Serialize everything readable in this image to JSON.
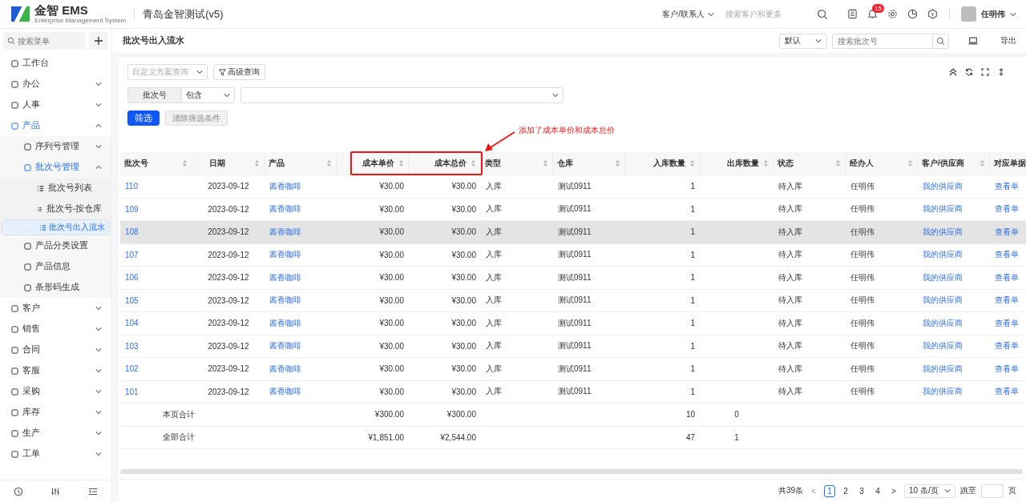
{
  "header": {
    "brand": "金智 EMS",
    "brand_sub": "Enterprise Management System",
    "company": "青岛金智测试(v5)",
    "search_scope": "客户/联系人",
    "search_placeholder": "搜索客户和更多",
    "notification_count": "15",
    "user": "任明伟"
  },
  "sidebar": {
    "search_placeholder": "搜索菜单",
    "items": [
      {
        "label": "工作台",
        "selected": false
      },
      {
        "label": "办公",
        "selected": false,
        "expanded": false
      },
      {
        "label": "人事",
        "selected": false,
        "expanded": false
      },
      {
        "label": "产品",
        "selected": false,
        "expanded": true,
        "active": true,
        "children": [
          {
            "label": "序列号管理",
            "selected": false,
            "expanded": false
          },
          {
            "label": "批次号管理",
            "selected": false,
            "expanded": true,
            "active": true,
            "children": [
              {
                "label": "批次号列表",
                "selected": false
              },
              {
                "label": "批次号-按仓库",
                "selected": false
              },
              {
                "label": "批次号出入流水",
                "selected": true
              }
            ]
          },
          {
            "label": "产品分类设置",
            "selected": false
          },
          {
            "label": "产品信息",
            "selected": false
          },
          {
            "label": "条形码生成",
            "selected": false
          }
        ]
      },
      {
        "label": "客户",
        "selected": false,
        "expanded": false
      },
      {
        "label": "销售",
        "selected": false,
        "expanded": false
      },
      {
        "label": "合同",
        "selected": false,
        "expanded": false
      },
      {
        "label": "客服",
        "selected": false,
        "expanded": false
      },
      {
        "label": "采购",
        "selected": false,
        "expanded": false
      },
      {
        "label": "库存",
        "selected": false,
        "expanded": false
      },
      {
        "label": "生产",
        "selected": false,
        "expanded": false
      },
      {
        "label": "工单",
        "selected": false,
        "expanded": false
      }
    ]
  },
  "page": {
    "title": "批次号出入流水",
    "view_select": "默认",
    "search_placeholder": "搜索批次号",
    "export": "导出"
  },
  "filters": {
    "scheme_placeholder": "自定义方案查询",
    "advanced": "高级查询",
    "field": "批次号",
    "operator": "包含",
    "buttons": [
      {
        "label": "筛选",
        "kind": "primary",
        "disabled": false
      },
      {
        "label": "清除筛选条件",
        "kind": "default",
        "disabled": true
      }
    ]
  },
  "annotation": {
    "text": "添加了成本单价和成本总价"
  },
  "table": {
    "columns": [
      {
        "label": "批次号",
        "kind": "link"
      },
      {
        "label": "日期",
        "kind": "date"
      },
      {
        "label": "产品",
        "kind": "link"
      },
      {
        "label": "成本单价",
        "kind": "number"
      },
      {
        "label": "成本总价",
        "kind": "number"
      },
      {
        "label": "类型",
        "kind": "text"
      },
      {
        "label": "仓库",
        "kind": "text"
      },
      {
        "label": "入库数量",
        "kind": "number"
      },
      {
        "label": "出库数量",
        "kind": "number"
      },
      {
        "label": "状态",
        "kind": "text"
      },
      {
        "label": "经办人",
        "kind": "text"
      },
      {
        "label": "客户/供应商",
        "kind": "link"
      },
      {
        "label": "对应单据",
        "kind": "link"
      }
    ],
    "rows": [
      {
        "highlighted": false,
        "cells": [
          "110",
          "2023-09-12",
          "酱香咖啡",
          "¥30.00",
          "¥30.00",
          "入库",
          "测试0911",
          "1",
          "",
          "待入库",
          "任明伟",
          "我的供应商",
          "查看单"
        ]
      },
      {
        "highlighted": false,
        "cells": [
          "109",
          "2023-09-12",
          "酱香咖啡",
          "¥30.00",
          "¥30.00",
          "入库",
          "测试0911",
          "1",
          "",
          "待入库",
          "任明伟",
          "我的供应商",
          "查看单"
        ]
      },
      {
        "highlighted": true,
        "cells": [
          "108",
          "2023-09-12",
          "酱香咖啡",
          "¥30.00",
          "¥30.00",
          "入库",
          "测试0911",
          "1",
          "",
          "待入库",
          "任明伟",
          "我的供应商",
          "查看单"
        ]
      },
      {
        "highlighted": false,
        "cells": [
          "107",
          "2023-09-12",
          "酱香咖啡",
          "¥30.00",
          "¥30.00",
          "入库",
          "测试0911",
          "1",
          "",
          "待入库",
          "任明伟",
          "我的供应商",
          "查看单"
        ]
      },
      {
        "highlighted": false,
        "cells": [
          "106",
          "2023-09-12",
          "酱香咖啡",
          "¥30.00",
          "¥30.00",
          "入库",
          "测试0911",
          "1",
          "",
          "待入库",
          "任明伟",
          "我的供应商",
          "查看单"
        ]
      },
      {
        "highlighted": false,
        "cells": [
          "105",
          "2023-09-12",
          "酱香咖啡",
          "¥30.00",
          "¥30.00",
          "入库",
          "测试0911",
          "1",
          "",
          "待入库",
          "任明伟",
          "我的供应商",
          "查看单"
        ]
      },
      {
        "highlighted": false,
        "cells": [
          "104",
          "2023-09-12",
          "酱香咖啡",
          "¥30.00",
          "¥30.00",
          "入库",
          "测试0911",
          "1",
          "",
          "待入库",
          "任明伟",
          "我的供应商",
          "查看单"
        ]
      },
      {
        "highlighted": false,
        "cells": [
          "103",
          "2023-09-12",
          "酱香咖啡",
          "¥30.00",
          "¥30.00",
          "入库",
          "测试0911",
          "1",
          "",
          "待入库",
          "任明伟",
          "我的供应商",
          "查看单"
        ]
      },
      {
        "highlighted": false,
        "cells": [
          "102",
          "2023-09-12",
          "酱香咖啡",
          "¥30.00",
          "¥30.00",
          "入库",
          "测试0911",
          "1",
          "",
          "待入库",
          "任明伟",
          "我的供应商",
          "查看单"
        ]
      },
      {
        "highlighted": false,
        "cells": [
          "101",
          "2023-09-12",
          "酱香咖啡",
          "¥30.00",
          "¥30.00",
          "入库",
          "测试0911",
          "1",
          "",
          "待入库",
          "任明伟",
          "我的供应商",
          "查看单"
        ]
      }
    ],
    "summaries": [
      {
        "label": "本页合计",
        "unit_cost": "¥300.00",
        "total_cost": "¥300.00",
        "in_qty": "10",
        "out_qty": "0"
      },
      {
        "label": "全部合计",
        "unit_cost": "¥1,851.00",
        "total_cost": "¥2,544.00",
        "in_qty": "47",
        "out_qty": "1"
      }
    ]
  },
  "pagination": {
    "total": "共39条",
    "prev": "<",
    "next": ">",
    "pages": [
      {
        "label": "1",
        "selected": true
      },
      {
        "label": "2",
        "selected": false
      },
      {
        "label": "3",
        "selected": false
      },
      {
        "label": "4",
        "selected": false
      }
    ],
    "page_size": "10 条/页",
    "jump_label": "跳至",
    "jump_suffix": "页"
  }
}
